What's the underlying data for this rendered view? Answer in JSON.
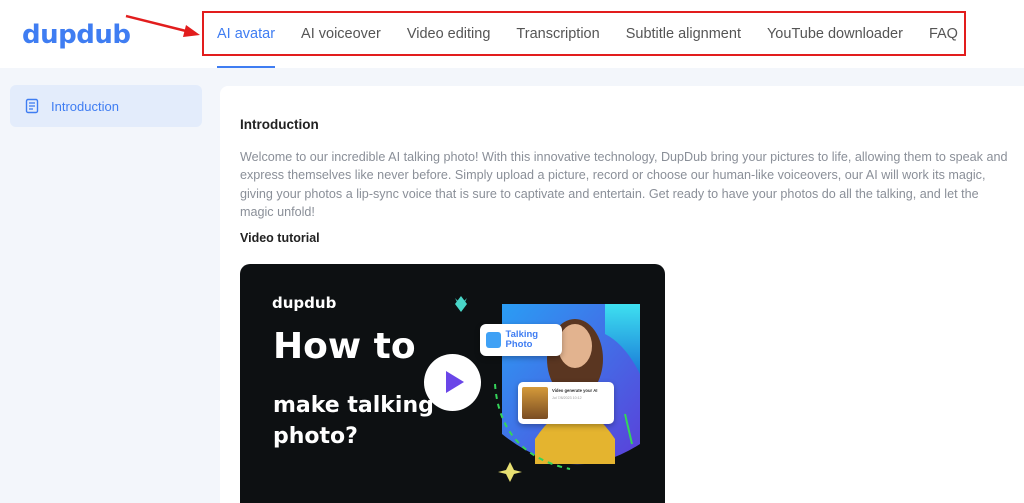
{
  "brand": {
    "logo_text": "dupdub",
    "accent": "#3f7df2"
  },
  "nav": {
    "items": [
      {
        "label": "AI avatar",
        "active": true
      },
      {
        "label": "AI voiceover",
        "active": false
      },
      {
        "label": "Video editing",
        "active": false
      },
      {
        "label": "Transcription",
        "active": false
      },
      {
        "label": "Subtitle alignment",
        "active": false
      },
      {
        "label": "YouTube downloader",
        "active": false
      },
      {
        "label": "FAQ",
        "active": false
      }
    ]
  },
  "sidebar": {
    "items": [
      {
        "label": "Introduction",
        "icon": "document-icon",
        "active": true
      }
    ]
  },
  "content": {
    "heading": "Introduction",
    "description": "Welcome to our incredible AI talking photo! With this innovative technology, DupDub bring your pictures to life, allowing them to speak and express themselves like never before. Simply upload a picture, record or choose our human-like voiceovers, our AI will work its magic, giving your photos a lip-sync voice that is sure to captivate and entertain. Get ready to have your photos do all the talking, and let the magic unfold!",
    "video_heading": "Video tutorial"
  },
  "video": {
    "logo_text": "dupdub",
    "title_line1": "How to",
    "title_line2": "make talking photo?",
    "badge_text": "Talking Photo",
    "card_text": "Video generate your AI",
    "card_date": "Jul 7/8/2023 10:12"
  },
  "annotation_color": "#e21d1d"
}
